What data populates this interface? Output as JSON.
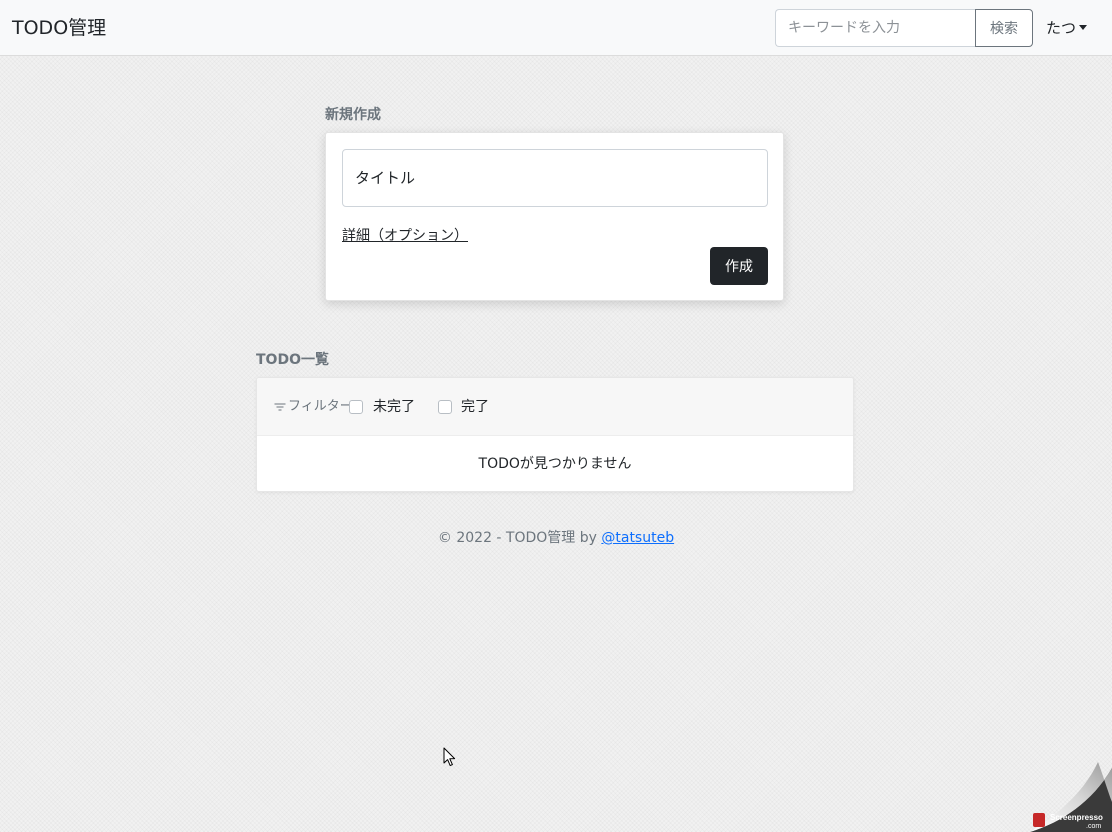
{
  "navbar": {
    "brand": "TODO管理",
    "search_placeholder": "キーワードを入力",
    "search_button": "検索",
    "user_menu": "たつ"
  },
  "new_todo": {
    "section_label": "新規作成",
    "title_placeholder": "タイトル",
    "detail_link": "詳細（オプション）",
    "create_button": "作成"
  },
  "todo_list": {
    "section_label": "TODO一覧",
    "filter_label": "フィルター",
    "filters": [
      {
        "label": "未完了",
        "checked": false
      },
      {
        "label": "完了",
        "checked": false
      }
    ],
    "empty_message": "TODOが見つかりません"
  },
  "footer": {
    "text": "© 2022 - TODO管理 by ",
    "link": "@tatsuteb"
  },
  "watermark": {
    "brand": "Screenpresso",
    "suffix": ".com"
  },
  "colors": {
    "primary_dark": "#212529",
    "muted": "#6c757d",
    "link": "#0d6efd",
    "navbar_bg": "#f8f9fa"
  },
  "icons": {
    "filter": "filter-icon",
    "user_menu_caret": "caret-down-icon",
    "cursor": "mouse-cursor-icon"
  }
}
